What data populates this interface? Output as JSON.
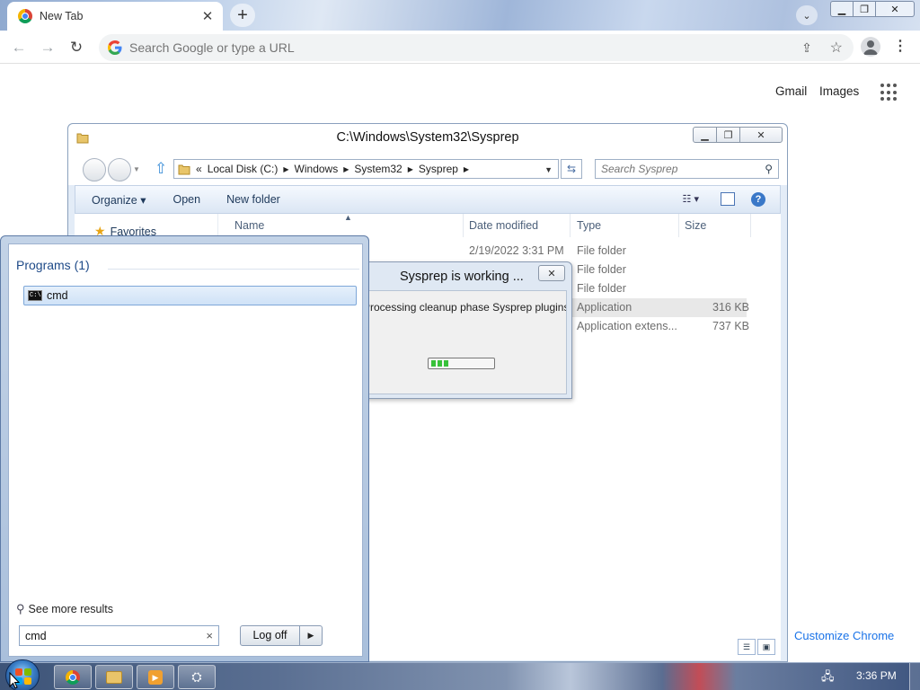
{
  "browser": {
    "tab": {
      "title": "New Tab",
      "close_glyph": "✕"
    },
    "new_tab_glyph": "+",
    "omnibox": {
      "placeholder": "Search Google or type a URL",
      "value": ""
    },
    "ntp": {
      "gmail": "Gmail",
      "images": "Images",
      "customize": "Customize Chrome"
    }
  },
  "explorer": {
    "title": "C:\\Windows\\System32\\Sysprep",
    "address": {
      "overflow": "«",
      "crumbs": [
        "Local Disk (C:)",
        "Windows",
        "System32",
        "Sysprep"
      ]
    },
    "search_placeholder": "Search Sysprep",
    "commands": {
      "organize": "Organize ▾",
      "open": "Open",
      "new_folder": "New folder"
    },
    "nav": {
      "favorites": "Favorites"
    },
    "columns": {
      "name": "Name",
      "date": "Date modified",
      "type": "Type",
      "size": "Size"
    },
    "rows": [
      {
        "date": "2/19/2022 3:31 PM",
        "type": "File folder",
        "size": ""
      },
      {
        "date": "",
        "type": "File folder",
        "size": ""
      },
      {
        "date": "",
        "type": "File folder",
        "size": ""
      },
      {
        "date": "",
        "type": "Application",
        "size": "316 KB"
      },
      {
        "date": "",
        "type": "Application extens...",
        "size": "737 KB"
      }
    ]
  },
  "sysprep": {
    "title": "Sysprep is working ...",
    "message": "Processing cleanup phase Sysprep plugins...",
    "progress_segments": 3
  },
  "startmenu": {
    "programs_header": "Programs (1)",
    "result": "cmd",
    "see_more": "See more results",
    "search_value": "cmd",
    "logoff": "Log off"
  },
  "taskbar": {
    "clock": "3:36 PM",
    "buttons": [
      "chrome",
      "explorer",
      "media-player",
      "network"
    ]
  },
  "colors": {
    "accent_blue": "#1a73e8",
    "progress_green": "#38c23a",
    "start_menu_header": "#1e4a88"
  }
}
